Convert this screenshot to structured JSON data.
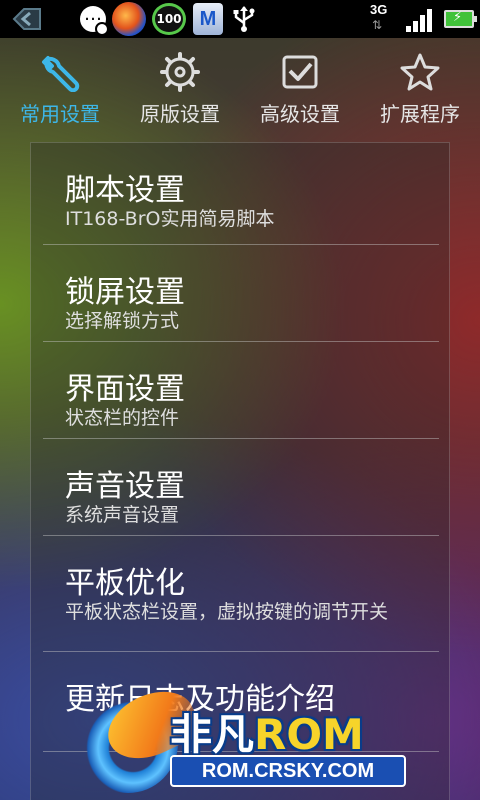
{
  "status_bar": {
    "badge_100": "100",
    "app_m": "M",
    "network": "3G",
    "network_arrows": "⇅"
  },
  "tabs": [
    {
      "label": "常用设置",
      "icon": "wrench-icon",
      "active": true
    },
    {
      "label": "原版设置",
      "icon": "gear-icon",
      "active": false
    },
    {
      "label": "高级设置",
      "icon": "checkbox-icon",
      "active": false
    },
    {
      "label": "扩展程序",
      "icon": "star-icon",
      "active": false
    }
  ],
  "items": [
    {
      "title": "脚本设置",
      "subtitle": "IT168-BrO实用简易脚本"
    },
    {
      "title": "锁屏设置",
      "subtitle": "选择解锁方式"
    },
    {
      "title": "界面设置",
      "subtitle": "状态栏的控件"
    },
    {
      "title": "声音设置",
      "subtitle": "系统声音设置"
    },
    {
      "title": "平板优化",
      "subtitle": "平板状态栏设置，虚拟按键的调节开关"
    },
    {
      "title": "更新日志及功能介绍",
      "subtitle": ""
    }
  ],
  "watermark": {
    "brand_cn": "非凡",
    "brand_rom": "ROM",
    "url": "ROM.CRSKY.COM"
  },
  "colors": {
    "accent": "#3db7e8",
    "statusbar": "#000000",
    "text": "#ffffff"
  }
}
